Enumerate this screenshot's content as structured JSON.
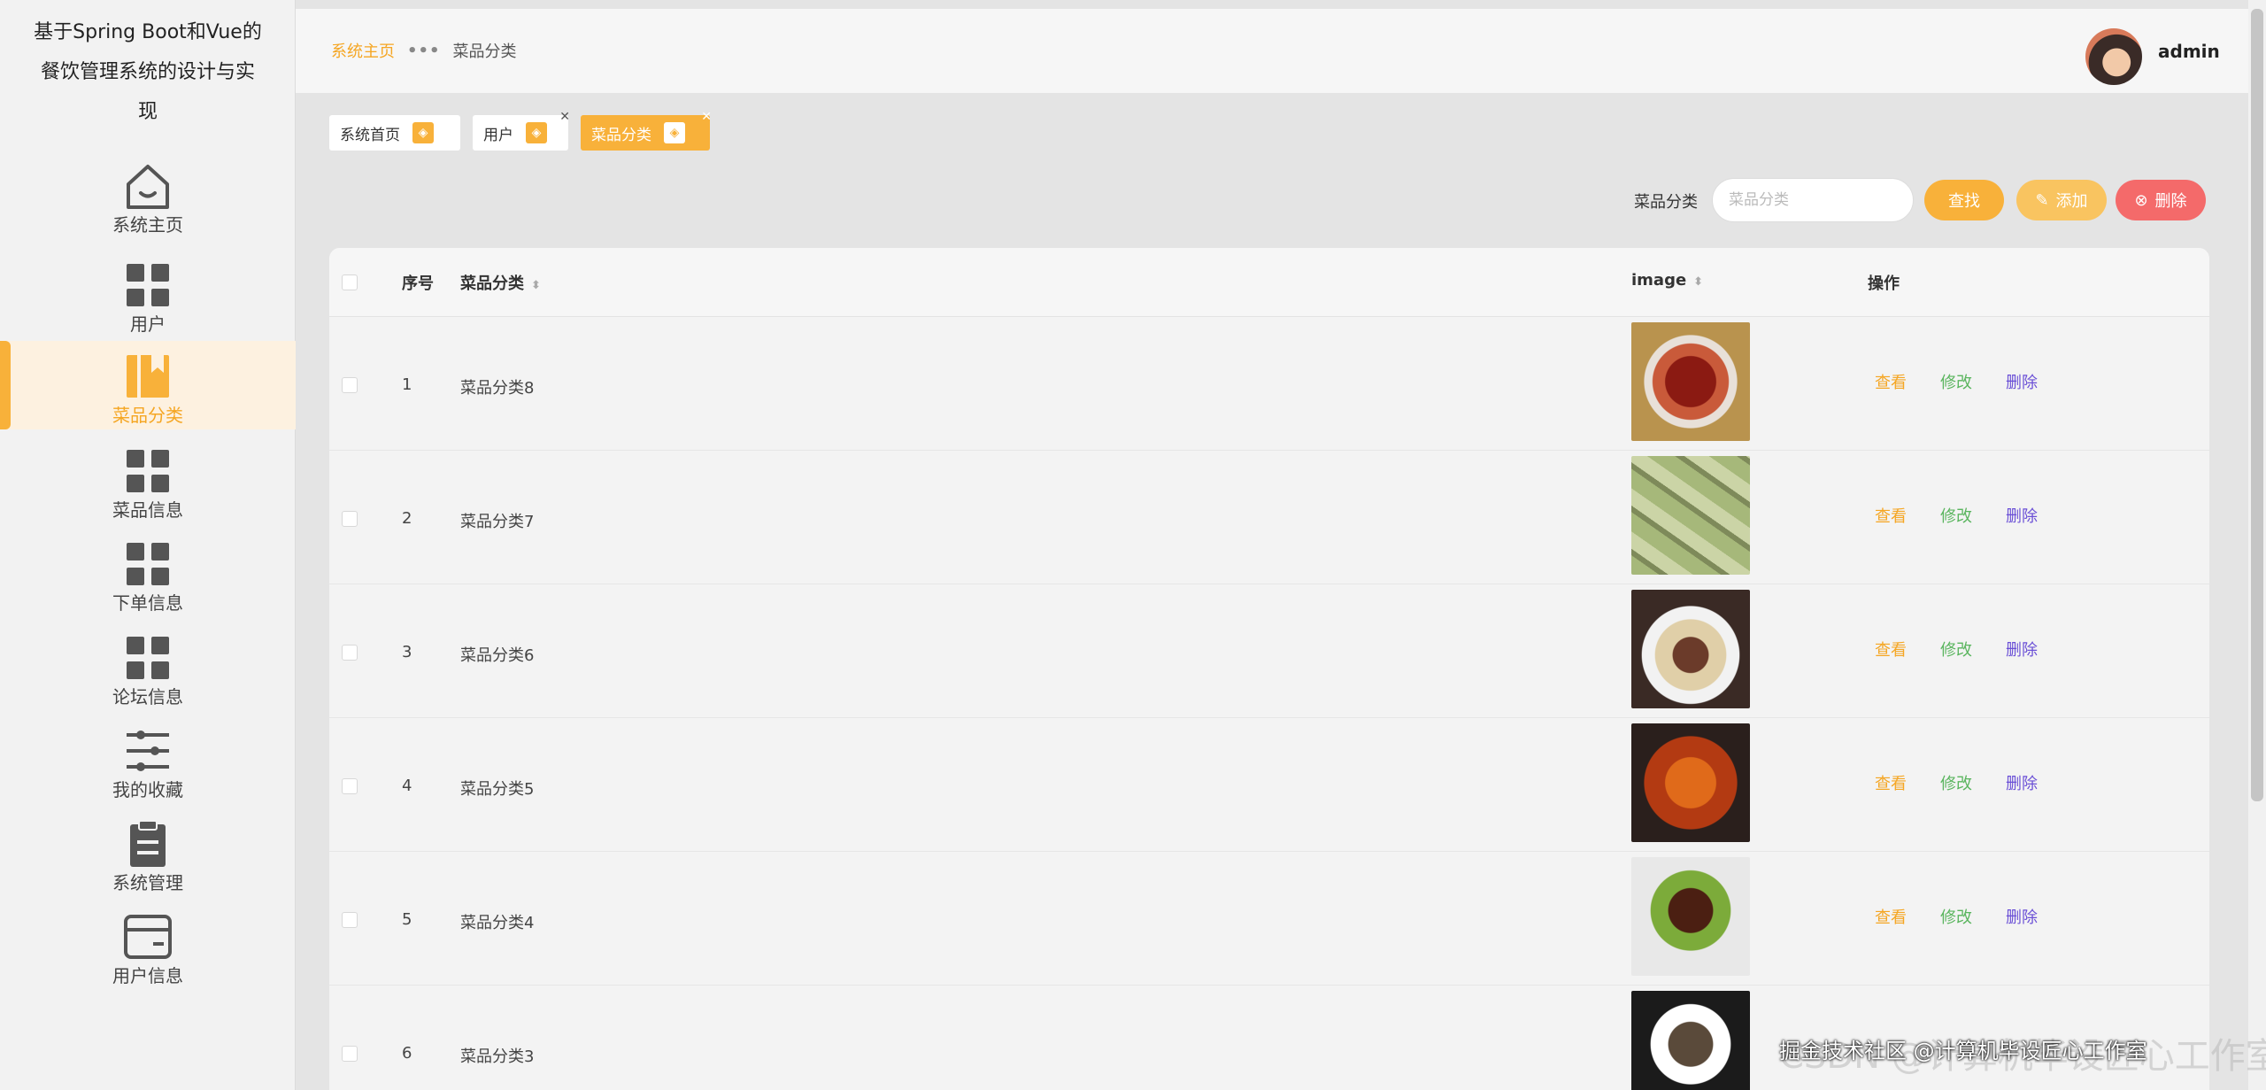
{
  "brand": {
    "line1": "基于Spring Boot和Vue的",
    "line2": "餐饮管理系统的设计与实",
    "line3": "现"
  },
  "sidebar": {
    "items": [
      {
        "label": "系统主页",
        "icon": "home-icon"
      },
      {
        "label": "用户",
        "icon": "grid-icon"
      },
      {
        "label": "菜品分类",
        "icon": "bookmark-icon",
        "active": true
      },
      {
        "label": "菜品信息",
        "icon": "grid-icon"
      },
      {
        "label": "下单信息",
        "icon": "grid-icon"
      },
      {
        "label": "论坛信息",
        "icon": "grid-icon"
      },
      {
        "label": "我的收藏",
        "icon": "sliders-icon"
      },
      {
        "label": "系统管理",
        "icon": "clipboard-icon"
      },
      {
        "label": "用户信息",
        "icon": "card-icon"
      }
    ]
  },
  "header": {
    "breadcrumb": {
      "home": "系统主页",
      "current": "菜品分类"
    },
    "username": "admin"
  },
  "tags": [
    {
      "label": "系统首页"
    },
    {
      "label": "用户"
    },
    {
      "label": "菜品分类",
      "active": true
    }
  ],
  "search": {
    "label": "菜品分类",
    "placeholder": "菜品分类",
    "value": "",
    "search_btn": "查找",
    "add_btn": "添加",
    "delete_btn": "删除"
  },
  "table": {
    "headers": {
      "index": "序号",
      "category": "菜品分类",
      "image": "image",
      "actions": "操作"
    },
    "rows": [
      {
        "index": "1",
        "name": "菜品分类8"
      },
      {
        "index": "2",
        "name": "菜品分类7"
      },
      {
        "index": "3",
        "name": "菜品分类6"
      },
      {
        "index": "4",
        "name": "菜品分类5"
      },
      {
        "index": "5",
        "name": "菜品分类4"
      },
      {
        "index": "6",
        "name": "菜品分类3"
      }
    ],
    "action_view": "查看",
    "action_edit": "修改",
    "action_delete": "删除"
  },
  "watermark": "掘金技术社区 @计算机毕设匠心工作室",
  "watermark_bg": "CSDN @计算机毕设匠心工作室",
  "colors": {
    "accent": "#f8b13a",
    "danger": "#f46a6a",
    "edit": "#5ab55e",
    "delete_link": "#6a4fd6"
  }
}
